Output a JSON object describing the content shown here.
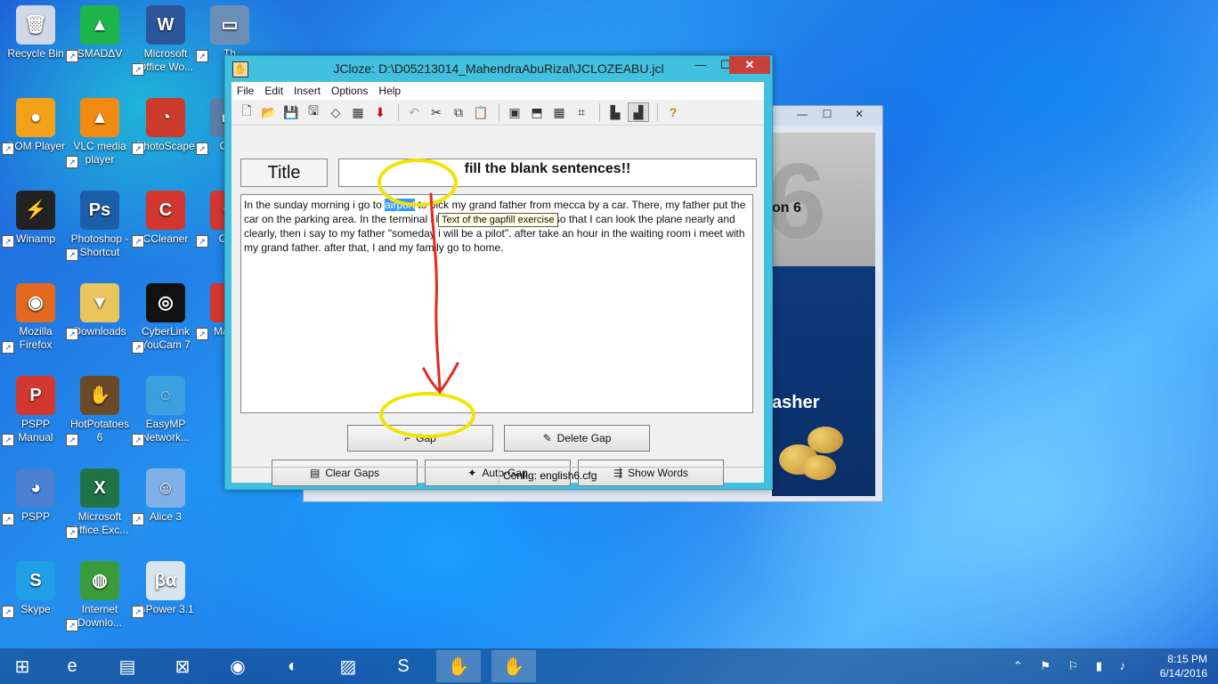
{
  "desktop": {
    "icons": [
      {
        "label": "Recycle Bin",
        "glyph": "🗑",
        "color": "#cfd8e6"
      },
      {
        "label": "SMADΔV",
        "glyph": "▲",
        "color": "#1db54a"
      },
      {
        "label": "Microsoft Office Wo...",
        "glyph": "W",
        "color": "#2b579a"
      },
      {
        "label": "Th",
        "glyph": "▭",
        "color": "#6c8fb8"
      },
      {
        "label": "GOM Player",
        "glyph": "●",
        "color": "#f4a11a"
      },
      {
        "label": "VLC media player",
        "glyph": "▲",
        "color": "#f08a12"
      },
      {
        "label": "PhotoScape",
        "glyph": "◔",
        "color": "#cc3b2c"
      },
      {
        "label": "O M",
        "glyph": "▭",
        "color": "#5b7ea8"
      },
      {
        "label": "Winamp",
        "glyph": "⚡",
        "color": "#222"
      },
      {
        "label": "Photoshop - Shortcut",
        "glyph": "Ps",
        "color": "#1c5fa8"
      },
      {
        "label": "CCleaner",
        "glyph": "C",
        "color": "#d2382f"
      },
      {
        "label": "Clea",
        "glyph": "C",
        "color": "#d2382f"
      },
      {
        "label": "Mozilla Firefox",
        "glyph": "◉",
        "color": "#e2691d"
      },
      {
        "label": "Downloads",
        "glyph": "▼",
        "color": "#e9c55c"
      },
      {
        "label": "CyberLink YouCam 7",
        "glyph": "◎",
        "color": "#111"
      },
      {
        "label": "Mac Fl",
        "glyph": "●",
        "color": "#d2382f"
      },
      {
        "label": "PSPP Manual",
        "glyph": "P",
        "color": "#d2382f"
      },
      {
        "label": "HotPotatoes 6",
        "glyph": "✋",
        "color": "#6b4a2a"
      },
      {
        "label": "EasyMP Network...",
        "glyph": "◌",
        "color": "#3aa0e0"
      },
      {
        "label": "PSPP",
        "glyph": "◕",
        "color": "#4a7fd1"
      },
      {
        "label": "Microsoft Office Exc...",
        "glyph": "X",
        "color": "#217346"
      },
      {
        "label": "Alice 3",
        "glyph": "☺",
        "color": "#7fb0e8"
      },
      {
        "label": "Skype",
        "glyph": "S",
        "color": "#1fa0e6"
      },
      {
        "label": "Internet Downlo...",
        "glyph": "◍",
        "color": "#3a9b3a"
      },
      {
        "label": "GPower 3.1",
        "glyph": "βα",
        "color": "#d9e4f1"
      }
    ]
  },
  "background_window": {
    "min": "—",
    "max": "☐",
    "close": "✕",
    "text_on6": "on 6",
    "text_six": "6",
    "text_asher": "asher"
  },
  "window": {
    "app_icon": "✋",
    "title": "JCloze: D:\\D05213014_MahendraAbuRizal\\JCLOZEABU.jcl",
    "min": "—",
    "max": "☐",
    "close": "✕"
  },
  "menu": [
    "File",
    "Edit",
    "Insert",
    "Options",
    "Help"
  ],
  "toolbar": {
    "group1": [
      "🗋",
      "📂",
      "💾",
      "🖫",
      "◇",
      "▦",
      "⬇"
    ],
    "group2": [
      "↶",
      "✂",
      "⧉",
      "📋"
    ],
    "group3": [
      "▣",
      "⬒",
      "▦",
      "⌗"
    ],
    "group4": [
      "▙",
      "▟"
    ],
    "group5": [
      "?"
    ]
  },
  "editor": {
    "title_label": "Title",
    "title_value": "fill the blank sentences!!",
    "text_before": "In the sunday morning i go to ",
    "text_selected": "airport",
    "text_after": " to pick my grand father from mecca by a car. There, my father put the car on the parking area. In the terminal i look the landing of plane so that I can look the plane nearly and clearly, then i say to my father \"someday i will be a pilot\". after take an hour in the waiting room i meet with my grand father. after that, I and my family go to home.",
    "tooltip": "Text of the gapfill exercise"
  },
  "buttons": {
    "gap": "Gap",
    "delete_gap": "Delete Gap",
    "clear_gaps": "Clear Gaps",
    "auto_gap": "Auto-Gap",
    "show_words": "Show Words"
  },
  "status": {
    "config": "Config: english6.cfg"
  },
  "taskbar": {
    "items": [
      {
        "name": "start",
        "glyph": "⊞"
      },
      {
        "name": "internet-explorer",
        "glyph": "e"
      },
      {
        "name": "file-explorer",
        "glyph": "▤"
      },
      {
        "name": "store",
        "glyph": "⊠"
      },
      {
        "name": "firefox",
        "glyph": "◉"
      },
      {
        "name": "paint",
        "glyph": "◐"
      },
      {
        "name": "sticky-notes",
        "glyph": "▨"
      },
      {
        "name": "skype",
        "glyph": "S"
      },
      {
        "name": "hotpotatoes",
        "glyph": "✋"
      },
      {
        "name": "jcloze",
        "glyph": "✋"
      }
    ],
    "time": "8:15 PM",
    "date": "6/14/2016",
    "tray": "⌃ ⚑ ⚐ ▮ ♪"
  }
}
